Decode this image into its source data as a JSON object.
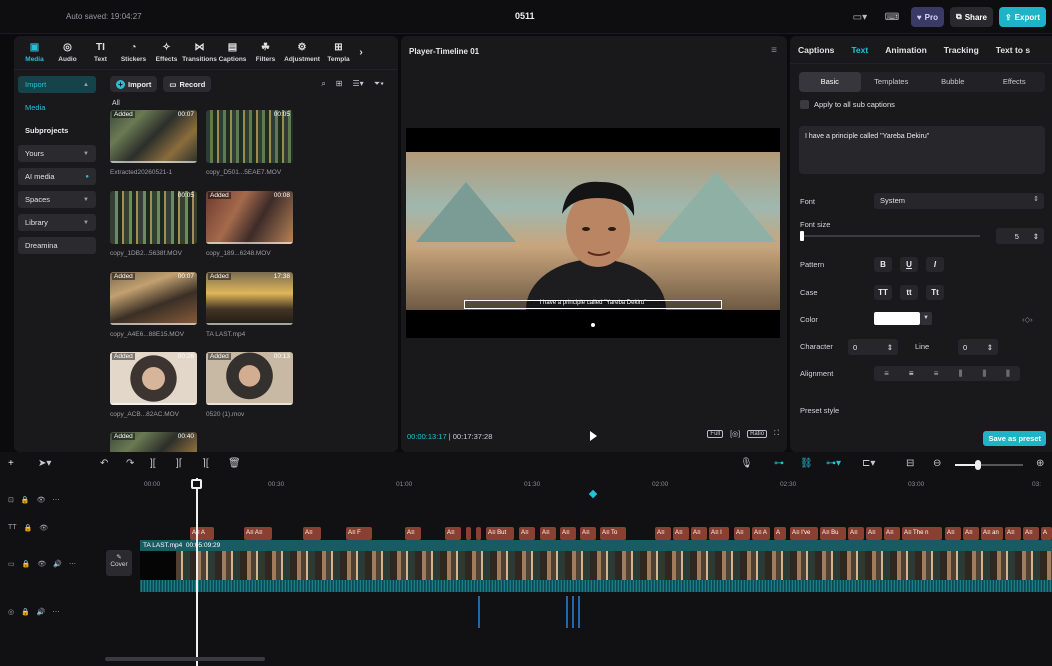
{
  "topbar": {
    "autosave": "Auto saved: 19:04:27",
    "project_name": "0511",
    "pro_label": "Pro",
    "share_label": "Share",
    "export_label": "Export"
  },
  "toolbar": {
    "items": [
      {
        "label": "Media",
        "icon": "media-icon"
      },
      {
        "label": "Audio",
        "icon": "audio-icon"
      },
      {
        "label": "Text",
        "icon": "text-icon"
      },
      {
        "label": "Stickers",
        "icon": "stickers-icon"
      },
      {
        "label": "Effects",
        "icon": "effects-icon"
      },
      {
        "label": "Transitions",
        "icon": "transitions-icon"
      },
      {
        "label": "Captions",
        "icon": "captions-icon"
      },
      {
        "label": "Filters",
        "icon": "filters-icon"
      },
      {
        "label": "Adjustment",
        "icon": "adjustment-icon"
      },
      {
        "label": "Templa",
        "icon": "templates-icon"
      }
    ]
  },
  "sidenav": {
    "import": "Import",
    "media": "Media",
    "subprojects": "Subprojects",
    "yours": "Yours",
    "ai_media": "AI media",
    "spaces": "Spaces",
    "library": "Library",
    "dreamina": "Dreamina"
  },
  "mediabar": {
    "import_btn": "Import",
    "record_btn": "Record",
    "filter_all": "All"
  },
  "media": [
    {
      "added": "Added",
      "duration": "00:07",
      "name": "Extracted20260521-1"
    },
    {
      "added": "",
      "duration": "00:05",
      "name": "copy_D501...5EAE7.MOV"
    },
    {
      "added": "",
      "duration": "00:05",
      "name": "copy_1DB2...5638f.MOV"
    },
    {
      "added": "Added",
      "duration": "00:08",
      "name": "copy_189...6248.MOV"
    },
    {
      "added": "Added",
      "duration": "00:07",
      "name": "copy_A4E6...88E15.MOV"
    },
    {
      "added": "Added",
      "duration": "17:38",
      "name": "TA LAST.mp4"
    },
    {
      "added": "Added",
      "duration": "00:26",
      "name": "copy_ACB...82AC.MOV"
    },
    {
      "added": "Added",
      "duration": "00:13",
      "name": "0520 (1).mov"
    },
    {
      "added": "Added",
      "duration": "00:40",
      "name": ""
    }
  ],
  "player": {
    "title": "Player-Timeline 01",
    "caption": "I have a principle called \"Yareba Dekiru\"",
    "current_time": "00:00:13:17",
    "total_time": "00:17:37:28",
    "full_label": "Full",
    "ratio_label": "Ratio"
  },
  "rightpanel": {
    "tabs": [
      "Captions",
      "Text",
      "Animation",
      "Tracking",
      "Text to s"
    ],
    "subtabs": [
      "Basic",
      "Templates",
      "Bubble",
      "Effects"
    ],
    "apply_all": "Apply to all sub captions",
    "text_value": "I have a principle called \"Yareba Dekiru\"",
    "font_label": "Font",
    "font_value": "System",
    "font_size_label": "Font size",
    "font_size_value": "5",
    "pattern_label": "Pattern",
    "case_label": "Case",
    "case_options": [
      "TT",
      "tt",
      "Tt"
    ],
    "color_label": "Color",
    "color_value": "#ffffff",
    "character_label": "Character",
    "character_value": "0",
    "line_label": "Line",
    "line_value": "0",
    "alignment_label": "Alignment",
    "preset_label": "Preset style",
    "save_preset": "Save as preset"
  },
  "timeline": {
    "ruler": [
      "00:00",
      "00:30",
      "01:00",
      "01:30",
      "02:00",
      "02:30",
      "03:00",
      "03:"
    ],
    "video_clip_name": "TA LAST.mp4",
    "video_clip_duration": "00:05:09:29",
    "cover_label": "Cover"
  },
  "colors": {
    "accent": "#22c2d6",
    "caption_clip": "#8a4031",
    "video_track": "#175c63"
  }
}
